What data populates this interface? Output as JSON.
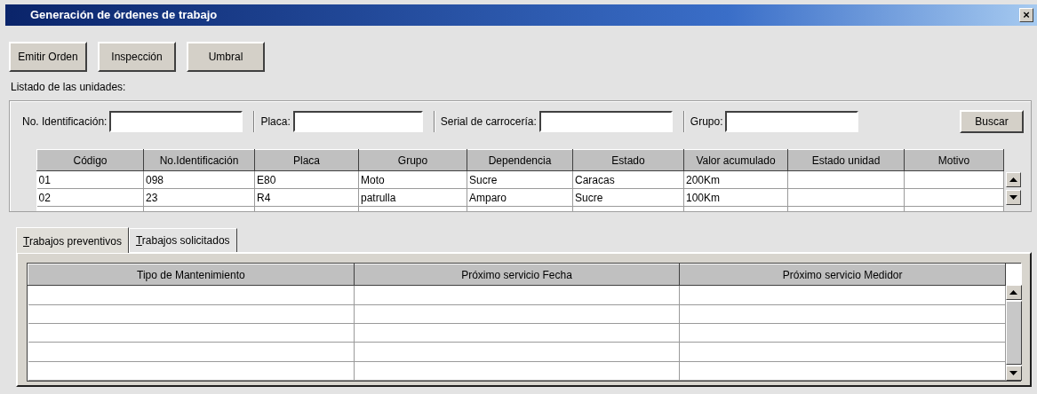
{
  "window": {
    "title": "Generación de órdenes de trabajo",
    "close": "×"
  },
  "actions": [
    "Emitir Orden",
    "Inspección",
    "Umbral"
  ],
  "units_label": "Listado de las unidades:",
  "filters": [
    {
      "label": "No. Identificación:"
    },
    {
      "label": "Placa:"
    },
    {
      "label": "Serial de carrocería:"
    },
    {
      "label": "Grupo:"
    }
  ],
  "search_button": "Buscar",
  "units_table": {
    "columns": [
      "Código",
      "No.Identificación",
      "Placa",
      "Grupo",
      "Dependencia",
      "Estado",
      "Valor acumulado",
      "Estado unidad",
      "Motivo"
    ],
    "rows": [
      {
        "cells": [
          "01",
          "098",
          "E80",
          "Moto",
          "Sucre",
          "Caracas",
          "200Km",
          null,
          null
        ]
      },
      {
        "cells": [
          "02",
          "23",
          "R4",
          "patrulla",
          "Amparo",
          "Sucre",
          "100Km",
          null,
          null
        ]
      }
    ]
  },
  "tabs": [
    {
      "label": "Trabajos preventivos",
      "selected": true
    },
    {
      "label": "Trabajos solicitados",
      "selected": false
    }
  ],
  "jobs_table": {
    "columns": [
      "Tipo de Mantenimiento",
      "Próximo servicio Fecha",
      "Próximo servicio Medidor"
    ]
  }
}
